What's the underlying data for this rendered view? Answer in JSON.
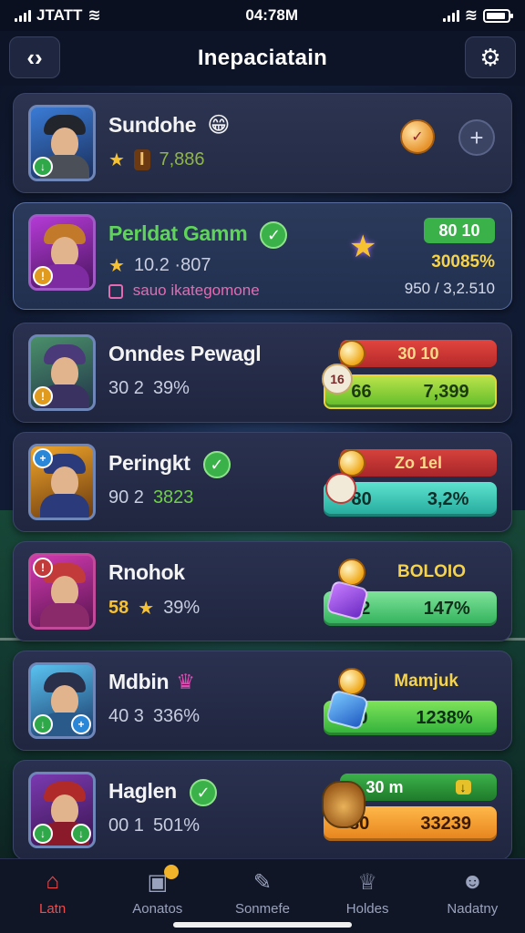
{
  "status_bar": {
    "carrier": "JTATT",
    "time": "04:78M"
  },
  "header": {
    "title": "Inepaciatain",
    "back_icon": "chevron-left-right-icon",
    "settings_icon": "gear-icon"
  },
  "players": [
    {
      "name": "Sundohe",
      "rank_value": "7,886",
      "rank_badge": "I",
      "emoji": "😁"
    },
    {
      "name": "Perldat Gamm",
      "stat": "10.2 ·807",
      "sub_label": "sauo ikategomone",
      "score_top": "80 10",
      "score_pct": "30085%",
      "score_bottom": "950 / 3,2.510"
    },
    {
      "name": "Onndes Pewagl",
      "stat_a": "30 2",
      "stat_b": "39%",
      "tag": "30 10",
      "badge_num": "16",
      "box_left": "66",
      "box_right": "7,399"
    },
    {
      "name": "Peringkt",
      "stat_a": "90 2",
      "stat_b": "3823",
      "tag": "Zo 1el",
      "box_left": "80",
      "box_right": "3,2%"
    },
    {
      "name": "Rnohok",
      "stat_a": "58",
      "stat_b": "39%",
      "tag": "BOLOIO",
      "box_left": "82",
      "box_right": "147%"
    },
    {
      "name": "Mdbin",
      "stat_a": "40 3",
      "stat_b": "336%",
      "tag": "Mamjuk",
      "box_left": "80",
      "box_right": "1238%"
    },
    {
      "name": "Haglen",
      "stat_a": "00 1",
      "stat_b": "501%",
      "tag": "30 m",
      "box_left": "80",
      "box_right": "33239"
    }
  ],
  "bottom_nav": [
    {
      "label": "Latn",
      "icon": "home-icon"
    },
    {
      "label": "Aonatos",
      "icon": "chest-icon"
    },
    {
      "label": "Sonmefe",
      "icon": "edit-icon"
    },
    {
      "label": "Holdes",
      "icon": "trophy-icon"
    },
    {
      "label": "Nadatny",
      "icon": "profile-icon"
    }
  ],
  "colors": {
    "accent_red": "#f24b4b",
    "green": "#3bb14a",
    "teal": "#27c7b8",
    "orange": "#f39a1e"
  }
}
